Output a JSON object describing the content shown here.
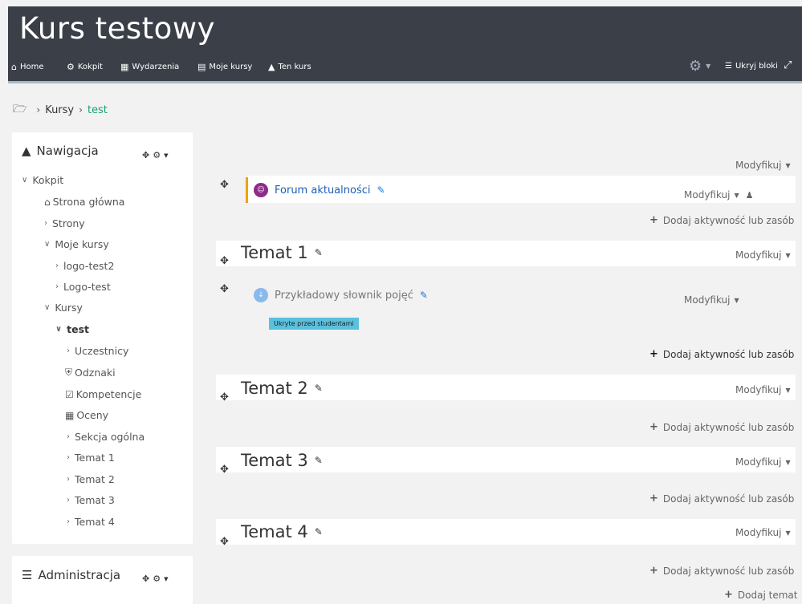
{
  "site_title": "Kurs testowy",
  "navbar": {
    "items": [
      {
        "label": "Home",
        "icon": "home-icon"
      },
      {
        "label": "Kokpit",
        "icon": "dashboard-icon"
      },
      {
        "label": "Wydarzenia",
        "icon": "calendar-icon"
      },
      {
        "label": "Moje kursy",
        "icon": "briefcase-icon"
      },
      {
        "label": "Ten kurs",
        "icon": "sitemap-icon"
      }
    ],
    "hide_blocks": "Ukryj bloki"
  },
  "breadcrumb": [
    "Kursy",
    "test"
  ],
  "navigation_block": {
    "title": "Nawigacja",
    "tree": [
      {
        "label": "Kokpit"
      },
      {
        "label": "Strona główna"
      },
      {
        "label": "Strony"
      },
      {
        "label": "Moje kursy"
      },
      {
        "label": "logo-test2"
      },
      {
        "label": "Logo-test"
      },
      {
        "label": "Kursy"
      },
      {
        "label": "test"
      },
      {
        "label": "Uczestnicy"
      },
      {
        "label": "Odznaki"
      },
      {
        "label": "Kompetencje"
      },
      {
        "label": "Oceny"
      },
      {
        "label": "Sekcja ogólna"
      },
      {
        "label": "Temat 1"
      },
      {
        "label": "Temat 2"
      },
      {
        "label": "Temat 3"
      },
      {
        "label": "Temat 4"
      }
    ]
  },
  "admin_block": {
    "title": "Administracja"
  },
  "course": {
    "modify_label": "Modyfikuj",
    "add_activity_label": "Dodaj aktywność lub zasób",
    "add_topic_label": "Dodaj temat",
    "forum_name": "Forum aktualności",
    "glossary_name": "Przykładowy słownik pojęć",
    "hidden_badge": "Ukryte przed studentami",
    "sections": [
      {
        "title": "Temat 1"
      },
      {
        "title": "Temat 2"
      },
      {
        "title": "Temat 3"
      },
      {
        "title": "Temat 4"
      }
    ]
  },
  "colors": {
    "header_bg": "#3a3f48",
    "link": "#1a5fb4",
    "breadcrumb_current": "#1a9e7a",
    "forum_icon": "#8e2b8a",
    "glossary_icon": "#8ab9ec",
    "hidden_badge": "#5bc0de",
    "forum_highlight": "#f0a30a"
  }
}
